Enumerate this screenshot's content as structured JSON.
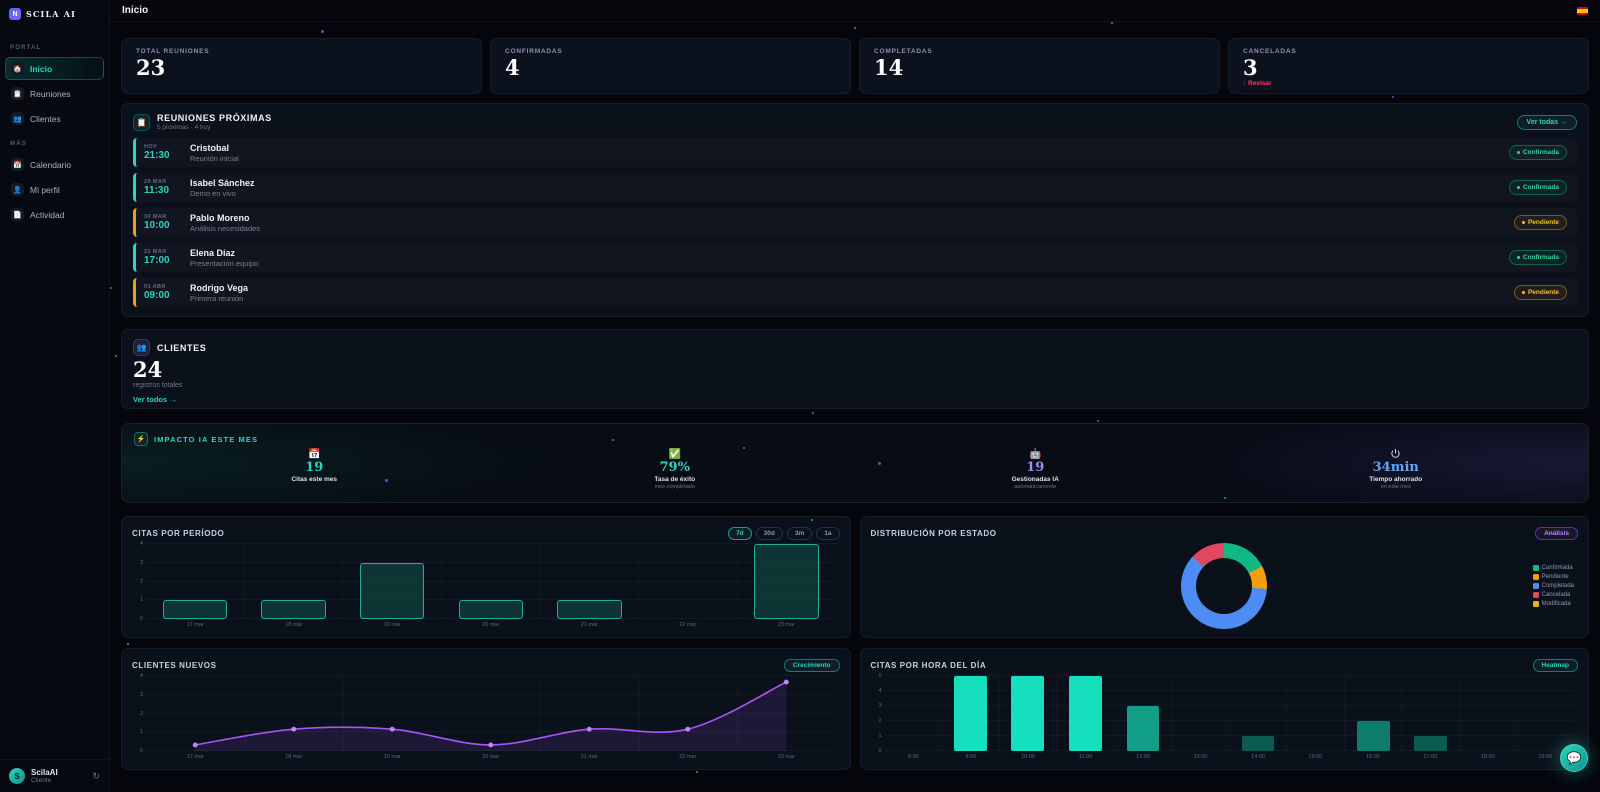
{
  "app": {
    "brand": "SCILA AI",
    "page_title": "Inicio",
    "logo_letter": "N"
  },
  "sidebar": {
    "sections": [
      {
        "label": "PORTAL",
        "items": [
          {
            "label": "Inicio",
            "icon": "🏠",
            "active": true
          },
          {
            "label": "Reuniones",
            "icon": "📋",
            "active": false
          },
          {
            "label": "Clientes",
            "icon": "👥",
            "active": false
          }
        ]
      },
      {
        "label": "MÁS",
        "items": [
          {
            "label": "Calendario",
            "icon": "📅",
            "active": false
          },
          {
            "label": "Mi perfil",
            "icon": "👤",
            "active": false
          },
          {
            "label": "Actividad",
            "icon": "📄",
            "active": false
          }
        ]
      }
    ],
    "user": {
      "name": "ScilaAI",
      "role": "Cliente",
      "avatar": "S"
    }
  },
  "stats": [
    {
      "label": "TOTAL REUNIONES",
      "value": "23"
    },
    {
      "label": "CONFIRMADAS",
      "value": "4"
    },
    {
      "label": "COMPLETADAS",
      "value": "14"
    },
    {
      "label": "CANCELADAS",
      "value": "3",
      "note": "↑ Revisar"
    }
  ],
  "meetings": {
    "title": "REUNIONES PRÓXIMAS",
    "subtitle": "5 próximas · 4 hoy",
    "icon": "📋",
    "view_all_label": "Ver todas →",
    "items": [
      {
        "date": "HOY",
        "time": "21:30",
        "name": "Cristobal",
        "detail": "Reunión inicial",
        "status": "Confirmada",
        "accent": "teal"
      },
      {
        "date": "29 MAR",
        "time": "11:30",
        "name": "Isabel Sánchez",
        "detail": "Demo en vivo",
        "status": "Confirmada",
        "accent": "teal"
      },
      {
        "date": "30 MAR",
        "time": "10:00",
        "name": "Pablo Moreno",
        "detail": "Análisis necesidades",
        "status": "Pendiente",
        "accent": "amber"
      },
      {
        "date": "31 MAR",
        "time": "17:00",
        "name": "Elena Díaz",
        "detail": "Presentación equipo",
        "status": "Confirmada",
        "accent": "teal"
      },
      {
        "date": "01 ABR",
        "time": "09:00",
        "name": "Rodrigo Vega",
        "detail": "Primera reunión",
        "status": "Pendiente",
        "accent": "amber"
      }
    ]
  },
  "clients": {
    "title": "CLIENTES",
    "icon": "👥",
    "value": "24",
    "subtitle": "registros totales",
    "view_all_label": "Ver todos →"
  },
  "impact": {
    "title": "IMPACTO IA ESTE MES",
    "icon": "⚡",
    "stats": [
      {
        "icon": "📅",
        "value": "19",
        "label": "Citas este mes",
        "sub": "",
        "color": "#2dd4bf"
      },
      {
        "icon": "✅",
        "value": "79%",
        "label": "Tasa de éxito",
        "sub": "mes completado",
        "color": "#2dd4bf"
      },
      {
        "icon": "🤖",
        "value": "19",
        "label": "Gestionadas IA",
        "sub": "automáticamente",
        "color": "#a78bfa"
      },
      {
        "icon": "power",
        "value": "34min",
        "label": "Tiempo ahorrado",
        "sub": "en este mes",
        "color": "#60a5fa"
      }
    ]
  },
  "chart_data": [
    {
      "id": "periodo",
      "type": "bar",
      "title": "CITAS POR PERÍODO",
      "filters": [
        "7d",
        "30d",
        "3m",
        "1a"
      ],
      "active_filter": "7d",
      "categories": [
        "17 mar",
        "18 mar",
        "19 mar",
        "20 mar",
        "21 mar",
        "22 mar",
        "23 mar"
      ],
      "values": [
        1,
        1,
        3,
        1,
        1,
        0,
        4
      ],
      "ylim": [
        0,
        4
      ],
      "yticks": [
        0,
        1,
        2,
        3,
        4
      ],
      "bar_color": "#2dd4bf",
      "grid": true
    },
    {
      "id": "estado",
      "type": "donut",
      "title": "DISTRIBUCIÓN POR ESTADO",
      "badge": "Análisis",
      "labels": [
        "Confirmada",
        "Pendiente",
        "Completada",
        "Cancelada",
        "Modificada"
      ],
      "values": [
        4,
        2,
        14,
        3,
        0
      ],
      "colors": [
        "#10b981",
        "#f59e0b",
        "#4e8cf5",
        "#e0485f",
        "#eab308"
      ],
      "legend_position": "right"
    },
    {
      "id": "clientes_nuevos",
      "type": "line",
      "title": "CLIENTES NUEVOS",
      "badge": "Crecimiento",
      "categories": [
        "17 mar",
        "18 mar",
        "19 mar",
        "20 mar",
        "21 mar",
        "22 mar",
        "23 mar"
      ],
      "values": [
        0,
        1,
        1,
        0,
        1,
        1,
        4
      ],
      "ylim": [
        0,
        4
      ],
      "yticks": [
        0,
        1,
        2,
        3,
        4
      ],
      "line_color": "#a855f7",
      "marker_color": "#c084fc",
      "grid": true
    },
    {
      "id": "horas",
      "type": "bar",
      "title": "CITAS POR HORA DEL DÍA",
      "badge": "Heatmap",
      "categories": [
        "8:00",
        "9:00",
        "10:00",
        "11:00",
        "12:00",
        "13:00",
        "14:00",
        "15:00",
        "16:00",
        "17:00",
        "18:00",
        "19:00"
      ],
      "values": [
        0,
        5,
        5,
        5,
        3,
        0,
        1,
        0,
        2,
        1,
        0,
        0
      ],
      "ylim": [
        0,
        5
      ],
      "yticks": [
        0,
        1,
        2,
        3,
        4,
        5
      ],
      "heat": true,
      "grid": true
    }
  ],
  "chat_button": {
    "icon": "💬"
  }
}
